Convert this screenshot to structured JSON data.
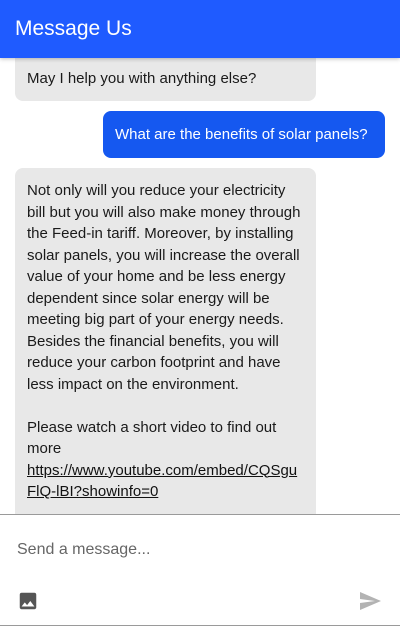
{
  "header": {
    "title": "Message Us"
  },
  "messages": [
    {
      "sender": "bot",
      "text": "May I help you with anything else?"
    },
    {
      "sender": "user",
      "text": "What are the benefits of solar panels?"
    },
    {
      "sender": "bot",
      "paragraph": "Not only will you reduce your electricity bill but you will also make money through the Feed-in tariff. Moreover, by installing solar panels, you will increase the overall value of your home and be less energy dependent since solar energy will be meeting big part of your energy needs. Besides the financial benefits, you will reduce your carbon footprint and have less impact on the environment.",
      "video_prompt": "Please watch a short video to find out more",
      "link": "https://www.youtube.com/embed/CQSguFlQ-lBI?showinfo=0"
    }
  ],
  "composer": {
    "placeholder": "Send a message...",
    "image_icon": "image-icon",
    "send_icon": "send-icon"
  },
  "colors": {
    "header": "#1f5bff",
    "user_bubble": "#1558f0",
    "bot_bubble": "#e8e8e8",
    "send_icon": "#b3b3b3",
    "image_icon": "#555555"
  }
}
